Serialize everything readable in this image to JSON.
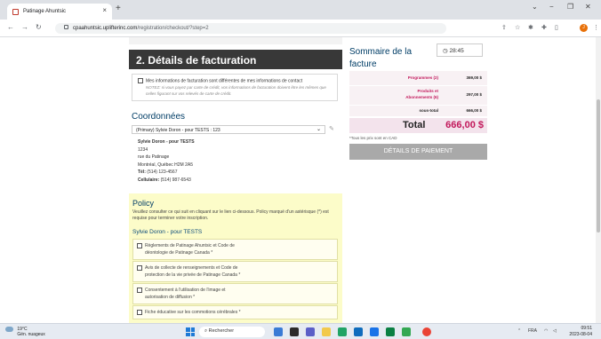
{
  "browser": {
    "tab_title": "Patinage Ahuntsic",
    "tab_close": "×",
    "new_tab": "+",
    "url_host": "cpaahuntsic.uplifterinc.com",
    "url_path": "/registration/checkout/?step=2",
    "profile_initial": "J",
    "window_controls": {
      "down": "⌄",
      "min": "−",
      "max": "❐",
      "close": "✕"
    }
  },
  "billing": {
    "section_title": "2. Détails de facturation",
    "different_label": "Mes informations de facturation sont différentes de mes informations de contact",
    "note": "NOTEZ: si vous payez par carte de crédit, vos informations de facturation doivent être les mêmes que celles figurant sur vos relevés de carte de crédit."
  },
  "coordinates": {
    "title": "Coordonnées",
    "selected": "(Primary) Sylvie Doron - pour TESTS : 123",
    "name": "Sylvie Doron - pour TESTS",
    "line1": "1234",
    "line2": "rue du Patinage",
    "line3": "Montréal, Québec H2M 2A5",
    "tel_label": "Tél:",
    "tel": "(514) 123-4567",
    "cell_label": "Cellulaire:",
    "cell": "(514) 987-6543"
  },
  "policy": {
    "title": "Policy",
    "text": "Veuillez consulter ce qui suit en cliquant sur le lien ci-dessous. Policy marqué d'un astérisque (*) est requise pour terminer votre inscription.",
    "person": "Sylvie Doron - pour TESTS",
    "items": [
      {
        "l1": "Règlements de Patinage Ahuntsic et Code de",
        "l2": "déontologie de Patinage Canada *"
      },
      {
        "l1": "Avis de collecte de renseignements et Code de",
        "l2": "protection de la vie privée de Patinage Canada *"
      },
      {
        "l1": "Consentement à l'utilisation de l'image et",
        "l2": "autorisation de diffusion *"
      },
      {
        "l1": "Fiche éducative sur les commotions cérébrales *",
        "l2": ""
      }
    ]
  },
  "summary": {
    "title": "Sommaire de la facture",
    "timer": "28:45",
    "programmes_label": "Programmes (2)",
    "programmes_value": "369,00 $",
    "produits_label": "Produits et Abonnements (6)",
    "produits_value": "297,00 $",
    "subtotal_label": "sous-total",
    "subtotal_value": "666,00 $",
    "total_label": "Total",
    "total_value": "666,00 $",
    "currency_note": "*Tous les prix sont en CAD",
    "pay_button": "DÉTAILS DE PAIEMENT"
  },
  "taskbar": {
    "temp": "19°C",
    "weather": "Gén. nuageux",
    "search": "Rechercher",
    "lang": "FRA",
    "time": "09:51",
    "date": "2023-08-04"
  }
}
